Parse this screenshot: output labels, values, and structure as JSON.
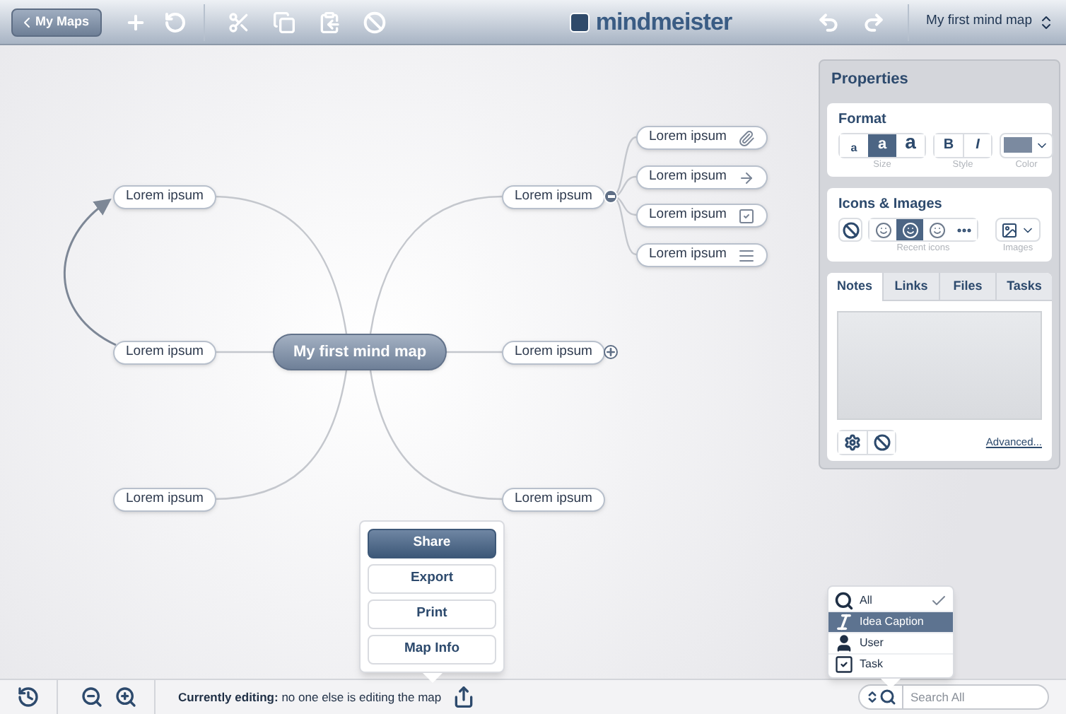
{
  "toolbar": {
    "back_button": "My Maps",
    "logo": "mindmeister",
    "map_selector": "My first mind map"
  },
  "map": {
    "central": "My first mind map",
    "left_nodes": [
      {
        "label": "Lorem ipsum"
      },
      {
        "label": "Lorem ipsum"
      },
      {
        "label": "Lorem ipsum"
      }
    ],
    "right_nodes": [
      {
        "label": "Lorem ipsum",
        "expanded": true,
        "children": [
          {
            "label": "Lorem ipsum",
            "kind": "attachment"
          },
          {
            "label": "Lorem ipsum",
            "kind": "link"
          },
          {
            "label": "Lorem ipsum",
            "kind": "task"
          },
          {
            "label": "Lorem ipsum",
            "kind": "note"
          }
        ]
      },
      {
        "label": "Lorem ipsum",
        "expanded": false
      },
      {
        "label": "Lorem ipsum"
      }
    ]
  },
  "properties": {
    "title": "Properties",
    "format": {
      "title": "Format",
      "sizes": [
        {
          "label": "a",
          "selected": false
        },
        {
          "label": "a",
          "selected": true
        },
        {
          "label": "a",
          "selected": false
        }
      ],
      "size_label": "Size",
      "styles": [
        "B",
        "I"
      ],
      "style_label": "Style",
      "color_label": "Color"
    },
    "icons": {
      "title": "Icons & Images",
      "recent": [
        {
          "selected": false
        },
        {
          "selected": true
        },
        {
          "selected": false
        }
      ],
      "recent_label": "Recent icons",
      "images_label": "Images"
    },
    "tabs": [
      {
        "label": "Notes",
        "selected": true
      },
      {
        "label": "Links",
        "selected": false
      },
      {
        "label": "Files",
        "selected": false
      },
      {
        "label": "Tasks",
        "selected": false
      }
    ],
    "advanced_link": "Advanced..."
  },
  "share_menu": [
    {
      "label": "Share",
      "selected": true
    },
    {
      "label": "Export",
      "selected": false
    },
    {
      "label": "Print",
      "selected": false
    },
    {
      "label": "Map Info",
      "selected": false
    }
  ],
  "search_menu": [
    {
      "kind": "all",
      "label": "All",
      "selected": false,
      "checked": true
    },
    {
      "kind": "caption",
      "label": "Idea Caption",
      "selected": true,
      "checked": false
    },
    {
      "kind": "user",
      "label": "User",
      "selected": false,
      "checked": false
    },
    {
      "kind": "task",
      "label": "Task",
      "selected": false,
      "checked": false
    }
  ],
  "status_bar": {
    "editing": "**Currently editing:** no one else is editing the map",
    "search": {
      "placeholder": "Search All"
    }
  }
}
